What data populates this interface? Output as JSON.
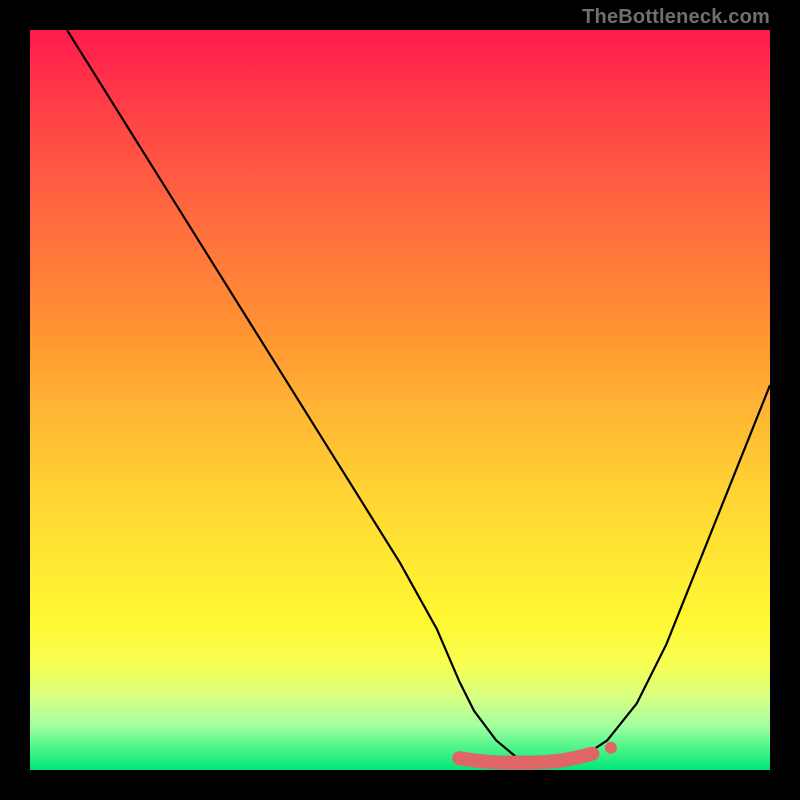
{
  "watermark": "TheBottleneck.com",
  "colors": {
    "background": "#000000",
    "gradient_top": "#ff1a4b",
    "gradient_mid": "#ffe833",
    "gradient_bottom": "#00e676",
    "curve": "#000000",
    "marker_fill": "#e06666",
    "marker_stroke": "#e06666"
  },
  "chart_data": {
    "type": "line",
    "title": "",
    "xlabel": "",
    "ylabel": "",
    "xlim": [
      0,
      100
    ],
    "ylim": [
      0,
      100
    ],
    "series": [
      {
        "name": "curve",
        "x": [
          5,
          10,
          15,
          20,
          25,
          30,
          35,
          40,
          45,
          50,
          55,
          58,
          60,
          63,
          66,
          70,
          73,
          75,
          78,
          82,
          86,
          90,
          94,
          98,
          100
        ],
        "values": [
          100,
          92,
          84,
          76,
          68,
          60,
          52,
          44,
          36,
          28,
          19,
          12,
          8,
          4,
          1.5,
          1,
          1.2,
          2,
          4,
          9,
          17,
          27,
          37,
          47,
          52
        ]
      }
    ],
    "markers": {
      "name": "bottom-cluster",
      "x": [
        58,
        60,
        62,
        64,
        66,
        68,
        70,
        72,
        74,
        76
      ],
      "values": [
        1.6,
        1.3,
        1.1,
        1.0,
        1.0,
        1.0,
        1.1,
        1.3,
        1.7,
        2.2
      ]
    }
  }
}
